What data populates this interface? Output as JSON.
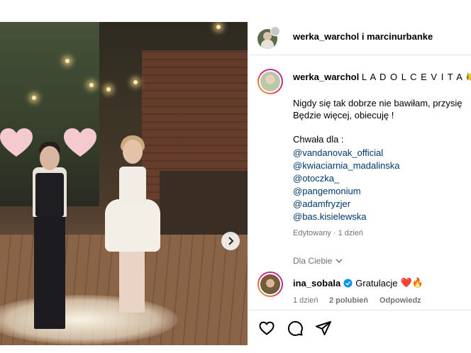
{
  "header": {
    "usernames": "werka_warchol i marcinurbanke"
  },
  "post": {
    "author": "werka_warchol",
    "caption_title": "L A D O L C E V I T A",
    "caption_emoji": "🍋",
    "lines": [
      "Nigdy się tak dobrze nie bawiłam, przysię",
      "Będzie więcej, obiecuję !"
    ],
    "thanks_label": "Chwała dla :",
    "mentions": [
      "@vandanovak_official",
      "@kwiaciarnia_madalinska",
      "@otoczka_",
      "@pangemonium",
      "@adamfryzjer",
      "@bas.kisielewska"
    ],
    "edited_meta": "Edytowany · 1 dzień"
  },
  "for_you": {
    "label": "Dla Ciebie",
    "chevron": "chevron-down-icon"
  },
  "comment": {
    "author": "ina_sobala",
    "verified": true,
    "text": "Gratulacje",
    "emojis": "❤️🔥",
    "time": "1 dzień",
    "likes": "2 polubień",
    "reply": "Odpowiedz"
  },
  "actions": {
    "like_icon": "heart-icon",
    "comment_icon": "comment-icon",
    "share_icon": "share-icon"
  },
  "colors": {
    "link": "#00376b",
    "muted": "#737373",
    "verified": "#0095f6",
    "heart_sticker": "#f4c9cf"
  }
}
